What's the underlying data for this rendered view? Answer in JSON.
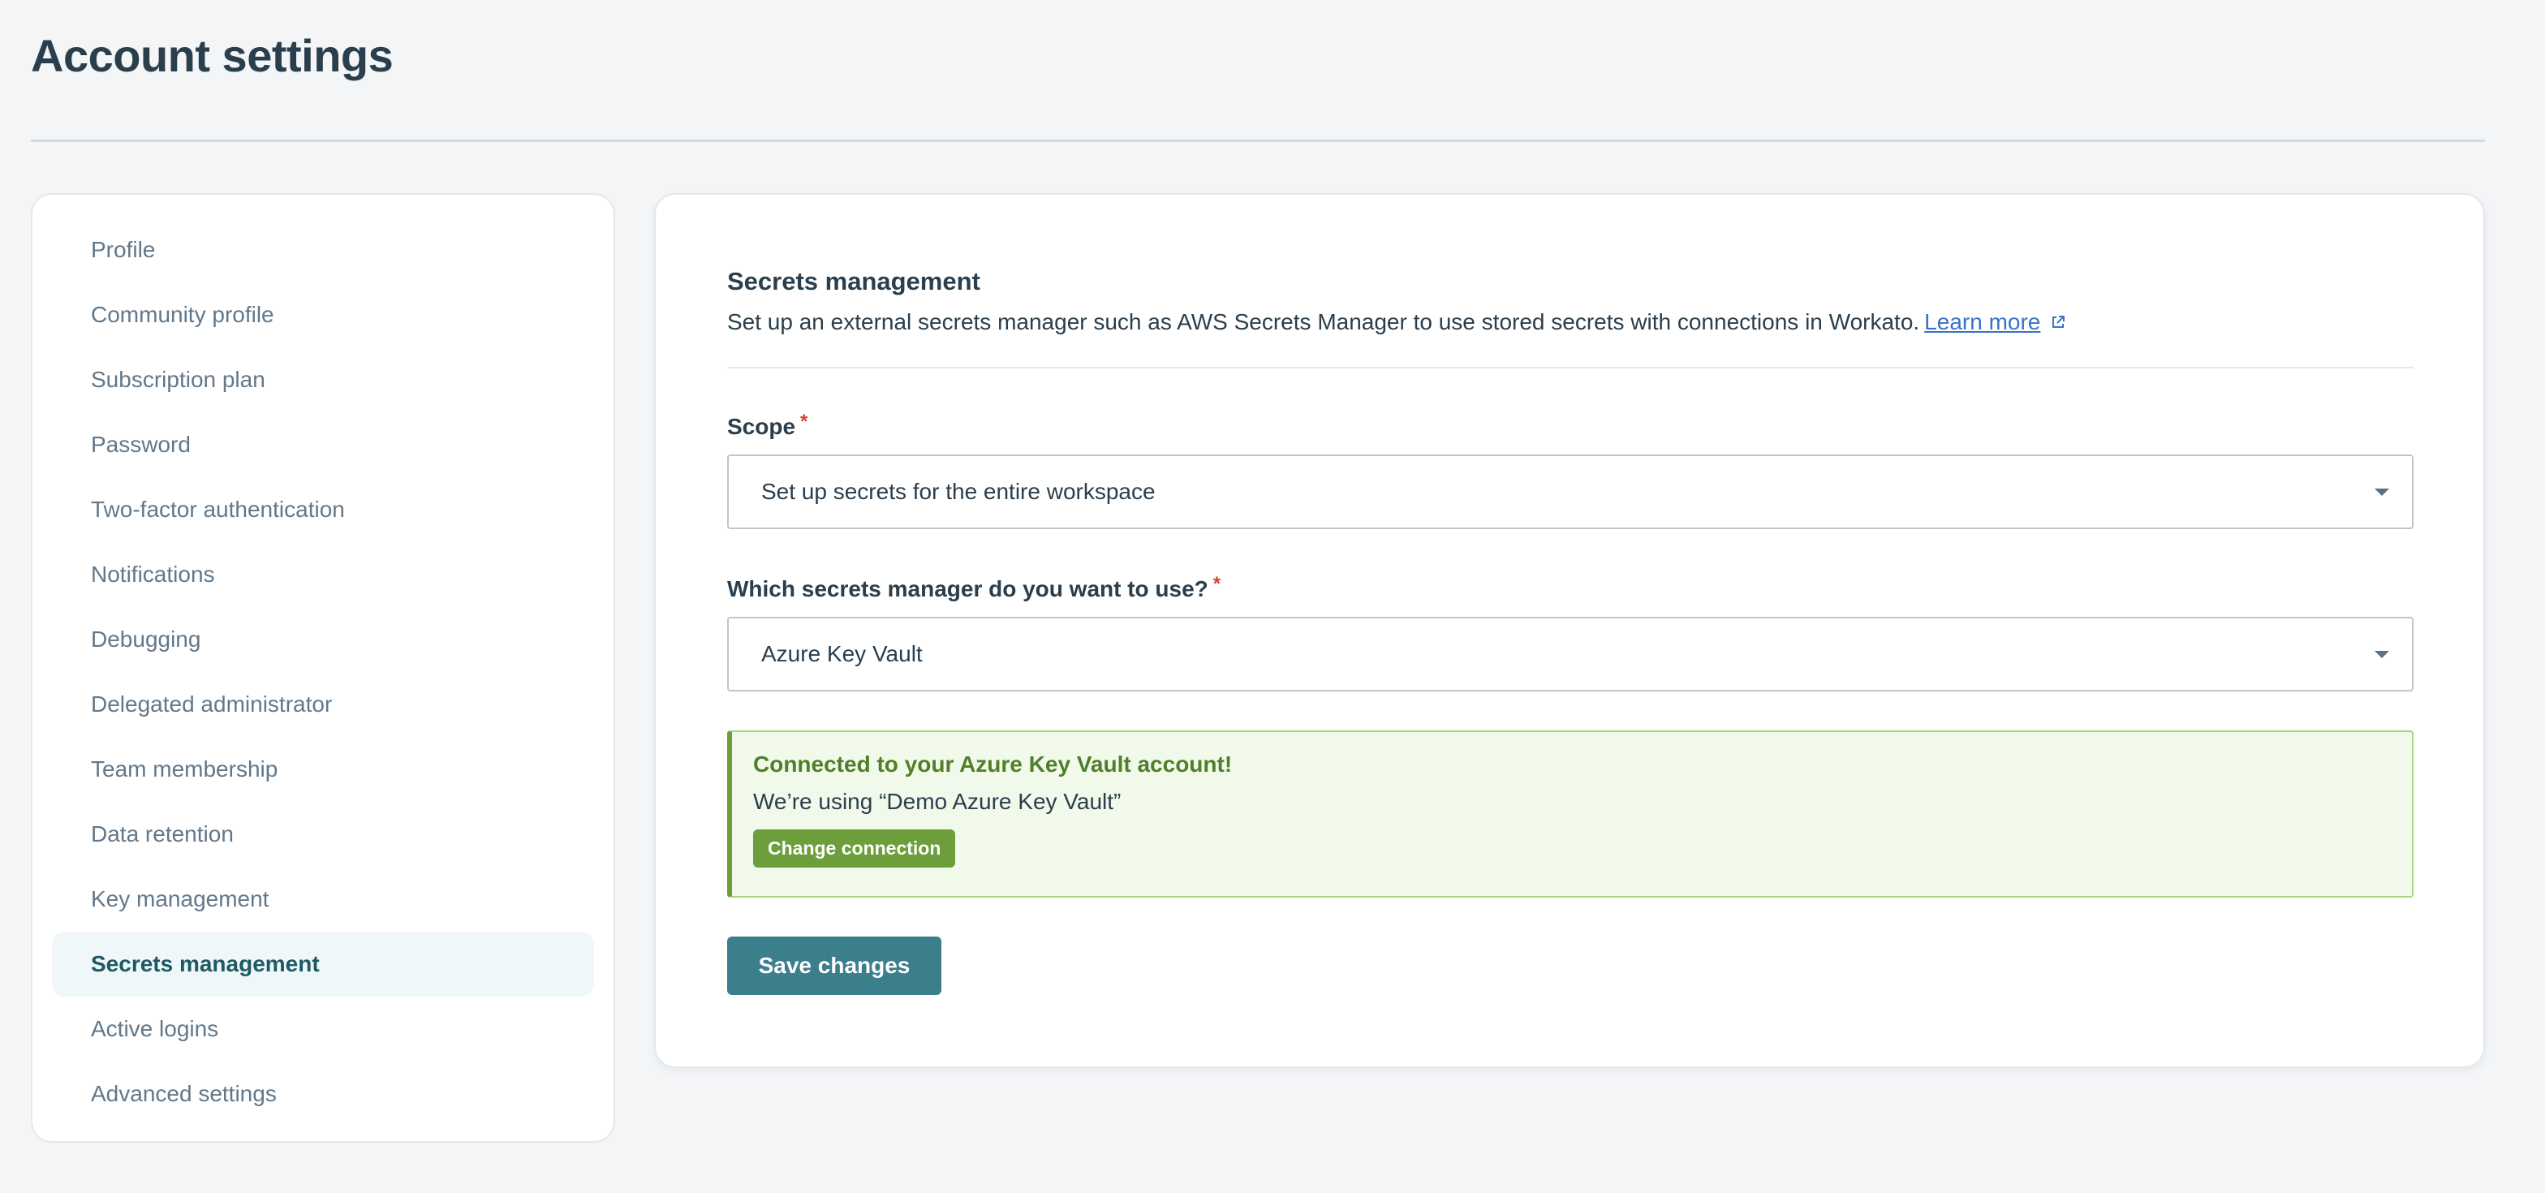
{
  "page": {
    "title": "Account settings"
  },
  "sidebar": {
    "items": [
      {
        "label": "Profile",
        "active": false
      },
      {
        "label": "Community profile",
        "active": false
      },
      {
        "label": "Subscription plan",
        "active": false
      },
      {
        "label": "Password",
        "active": false
      },
      {
        "label": "Two-factor authentication",
        "active": false
      },
      {
        "label": "Notifications",
        "active": false
      },
      {
        "label": "Debugging",
        "active": false
      },
      {
        "label": "Delegated administrator",
        "active": false
      },
      {
        "label": "Team membership",
        "active": false
      },
      {
        "label": "Data retention",
        "active": false
      },
      {
        "label": "Key management",
        "active": false
      },
      {
        "label": "Secrets management",
        "active": true
      },
      {
        "label": "Active logins",
        "active": false
      },
      {
        "label": "Advanced settings",
        "active": false
      }
    ]
  },
  "main": {
    "section_title": "Secrets management",
    "description": "Set up an external secrets manager such as AWS Secrets Manager to use stored secrets with connections in Workato.",
    "learn_more_label": "Learn more",
    "learn_more_icon": "external-link-icon",
    "scope": {
      "label": "Scope",
      "required_marker": "*",
      "value": "Set up secrets for the entire workspace"
    },
    "manager": {
      "label": "Which secrets manager do you want to use?",
      "required_marker": "*",
      "value": "Azure Key Vault"
    },
    "alert": {
      "title": "Connected to your Azure Key Vault account!",
      "body": "We’re using “Demo Azure Key Vault”",
      "button_label": "Change connection"
    },
    "save_label": "Save changes"
  },
  "colors": {
    "primary": "#3b7f8c",
    "success": "#6c9e3c",
    "success_bg": "#f1f9ea",
    "link": "#3a72c7",
    "required": "#d2442c",
    "active_nav_bg": "#eff7f9"
  }
}
